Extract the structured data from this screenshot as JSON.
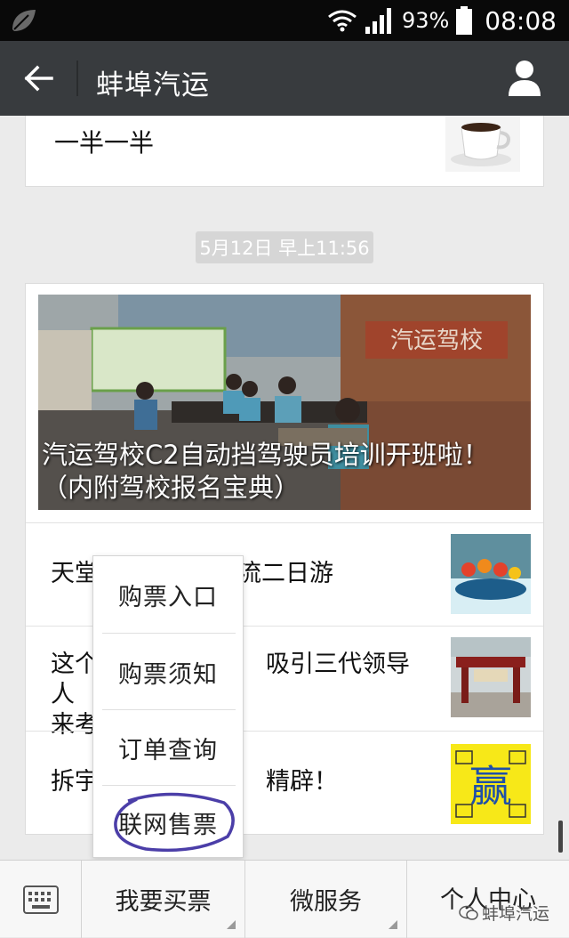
{
  "status_bar": {
    "battery_percent": "93%",
    "time": "08:08",
    "icons": [
      "leaf-icon",
      "wifi-icon",
      "signal-icon",
      "battery-icon"
    ]
  },
  "header": {
    "title": "蚌埠汽运",
    "back_icon": "arrow-left-icon",
    "profile_icon": "user-icon"
  },
  "previous_message": {
    "text": "一半一半"
  },
  "timestamp": "5月12日 早上11:56",
  "news": {
    "hero_title": "汽运驾校C2自动挡驾驶员培训开班啦！（内附驾校报名宝典）",
    "hero_sign": "汽运驾校",
    "items": [
      {
        "title": "天堂",
        "title_tail": "流二日游"
      },
      {
        "title_line1": "这个",
        "title_line1_tail": "吸引三代领导人",
        "title_line2": "来考"
      },
      {
        "title": "拆宇",
        "title_tail": "精辟！"
      }
    ],
    "thumb4_char": "赢"
  },
  "popup_menu": {
    "items": [
      "购票入口",
      "购票须知",
      "订单查询",
      "联网售票"
    ]
  },
  "bottom_menu": {
    "tabs": [
      "我要买票",
      "微服务",
      "个人中心"
    ],
    "keyboard_icon": "keyboard-icon"
  },
  "watermark": "蚌埠汽运",
  "colors": {
    "title_bar": "#383b3e",
    "status_bar": "#090909",
    "background": "#ebebeb",
    "circle_mark": "#4b3ea8"
  }
}
